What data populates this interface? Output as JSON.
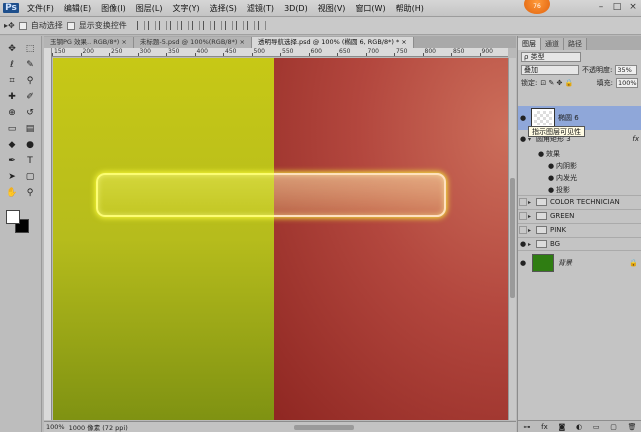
{
  "app": {
    "logo": "Ps",
    "version_badge": "76"
  },
  "menu": [
    "文件(F)",
    "编辑(E)",
    "图像(I)",
    "图层(L)",
    "文字(Y)",
    "选择(S)",
    "滤镜(T)",
    "3D(D)",
    "视图(V)",
    "窗口(W)",
    "帮助(H)"
  ],
  "window_controls": [
    "–",
    "□",
    "×"
  ],
  "options": {
    "auto_select": "自动选择",
    "show_transform": "显示变换控件",
    "align_icons": [
      "top",
      "vcenter",
      "bottom",
      "left",
      "hcenter",
      "right",
      "dist1",
      "dist2",
      "dist3",
      "dist4",
      "dist5",
      "dist6"
    ]
  },
  "tools": [
    "move",
    "marquee",
    "lasso",
    "quick-select",
    "crop",
    "eyedropper",
    "healing",
    "brush",
    "clone",
    "history",
    "eraser",
    "gradient",
    "blur",
    "dodge",
    "pen",
    "type",
    "path-select",
    "shape",
    "hand",
    "zoom"
  ],
  "colors": {
    "foreground": "#ffffff",
    "background": "#000000",
    "canvas_left": "#c4c61a",
    "canvas_right": "#b3473e",
    "glow": "#ffff60"
  },
  "doc_tabs": [
    {
      "label": "玉钢PG 效果.. RGB/8*) ×",
      "active": false
    },
    {
      "label": "未标题-5.psd @ 100%(RGB/8*) ×",
      "active": false
    },
    {
      "label": "透明导航选择.psd @ 100% (椭圆 6, RGB/8*) * ×",
      "active": true
    }
  ],
  "ruler": {
    "ticks": [
      "150",
      "200",
      "250",
      "300",
      "350",
      "400",
      "450",
      "500",
      "550",
      "600",
      "650",
      "700",
      "750",
      "800",
      "850",
      "900"
    ]
  },
  "status": {
    "zoom": "100%",
    "info": "1000 像素 (72 ppi)"
  },
  "layers_panel": {
    "tabs": [
      {
        "label": "图层",
        "active": true
      },
      {
        "label": "通道",
        "active": false
      },
      {
        "label": "路径",
        "active": false
      }
    ],
    "kind_filter": "ρ 类型",
    "blend_mode": "叠加",
    "opacity_label": "不透明度:",
    "opacity_value": "35%",
    "lock_label": "锁定:",
    "fill_label": "填充:",
    "fill_value": "100%",
    "layers": [
      {
        "name": "椭圆 6",
        "selected": true
      },
      {
        "name": "圆角矩形 3"
      },
      {
        "name": "效果"
      },
      {
        "name": "内阴影"
      },
      {
        "name": "内发光"
      },
      {
        "name": "投影"
      },
      {
        "name": "COLOR TECHNICIAN"
      },
      {
        "name": "GREEN"
      },
      {
        "name": "PINK"
      },
      {
        "name": "BG"
      },
      {
        "name": "背景"
      }
    ],
    "tooltip": "指示图层可见性",
    "fx_label": "fx",
    "bottom_icons": [
      "link-icon",
      "fx-icon",
      "mask-icon",
      "adjust-icon",
      "group-icon",
      "new-layer-icon",
      "trash-icon"
    ]
  }
}
